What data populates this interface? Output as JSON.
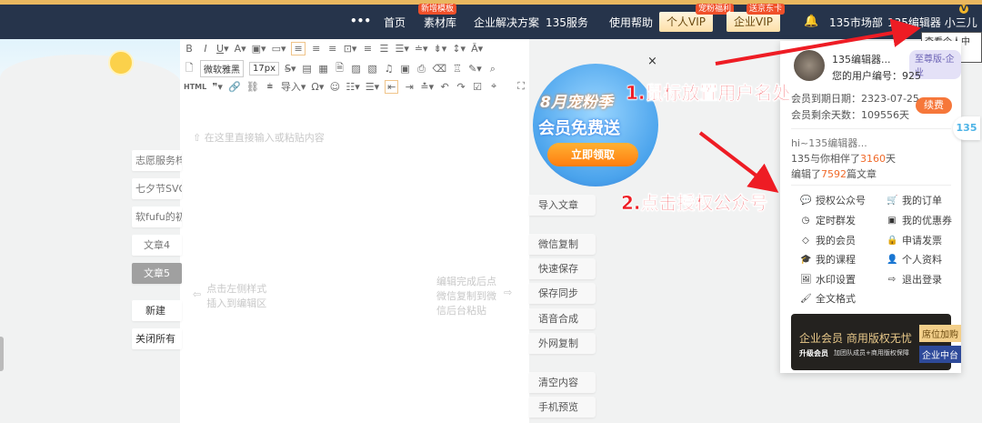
{
  "nav": {
    "more": "•••",
    "items": [
      "首页",
      "素材库",
      "企业解决方案",
      "135服务",
      "使用帮助"
    ],
    "material_badge": "新增模板",
    "vip_personal": "个人VIP",
    "vip_personal_badge": "宠粉福利",
    "vip_enterprise": "企业VIP",
    "vip_enterprise_badge": "送京东卡",
    "market": "135市场部",
    "user": "135编辑器 小三儿",
    "tooltip": "查看个人中心"
  },
  "toolbar": {
    "font": "微软雅黑",
    "size": "17px",
    "html": "HTML",
    "import": "导入"
  },
  "editor": {
    "placeholder": "在这里直接输入或粘贴内容",
    "left_hint": "点击左侧样式插入到编辑区",
    "right_hint": "编辑完成后点微信复制到微信后台粘贴"
  },
  "tabs": [
    "志愿服务梓",
    "七夕节SVG",
    "软fufu的初",
    "文章4",
    "文章5",
    "新建",
    "关闭所有"
  ],
  "right_buttons": [
    "导入文章",
    "微信复制",
    "快速保存",
    "保存同步",
    "语音合成",
    "外网复制",
    "清空内容",
    "手机预览"
  ],
  "banner": {
    "title": "8月宠粉季",
    "subtitle": "会员免费送",
    "button": "立即领取",
    "close": "×"
  },
  "panel": {
    "name": "135编辑器...",
    "tag": "至尊版-企业",
    "user_id_label": "您的用户编号：",
    "user_id": "925",
    "expire_label": "会员到期日期：",
    "expire": "2323-07-25",
    "remain_label": "会员剩余天数：",
    "remain": "109556天",
    "renew": "续费",
    "greeting": "hi~135编辑器...",
    "together_pre": "135与你相伴了",
    "together_days": "3160",
    "together_post": "天",
    "edited_pre": "编辑了",
    "edited_count": "7592",
    "edited_post": "篇文章",
    "menu": [
      {
        "label": "授权公众号",
        "icon": "wechat-icon"
      },
      {
        "label": "我的订单",
        "icon": "cart-icon"
      },
      {
        "label": "定时群发",
        "icon": "clock-icon"
      },
      {
        "label": "我的优惠券",
        "icon": "coupon-icon"
      },
      {
        "label": "我的会员",
        "icon": "diamond-icon"
      },
      {
        "label": "申请发票",
        "icon": "lock-icon"
      },
      {
        "label": "我的课程",
        "icon": "graduation-icon"
      },
      {
        "label": "个人资料",
        "icon": "user-icon"
      },
      {
        "label": "水印设置",
        "icon": "image-icon"
      },
      {
        "label": "退出登录",
        "icon": "logout-icon"
      },
      {
        "label": "全文格式",
        "icon": "brush-icon"
      }
    ],
    "promo": {
      "title": "企业会员 商用版权无忧",
      "upgrade": "升级会员",
      "desc": "加团队成员+商用版权保障",
      "seat": "席位加购",
      "center": "企业中台"
    }
  },
  "side_logo": "135",
  "annotations": {
    "step1": "1.鼠标放置用户名处",
    "step2": "2.点击授权公众号"
  }
}
